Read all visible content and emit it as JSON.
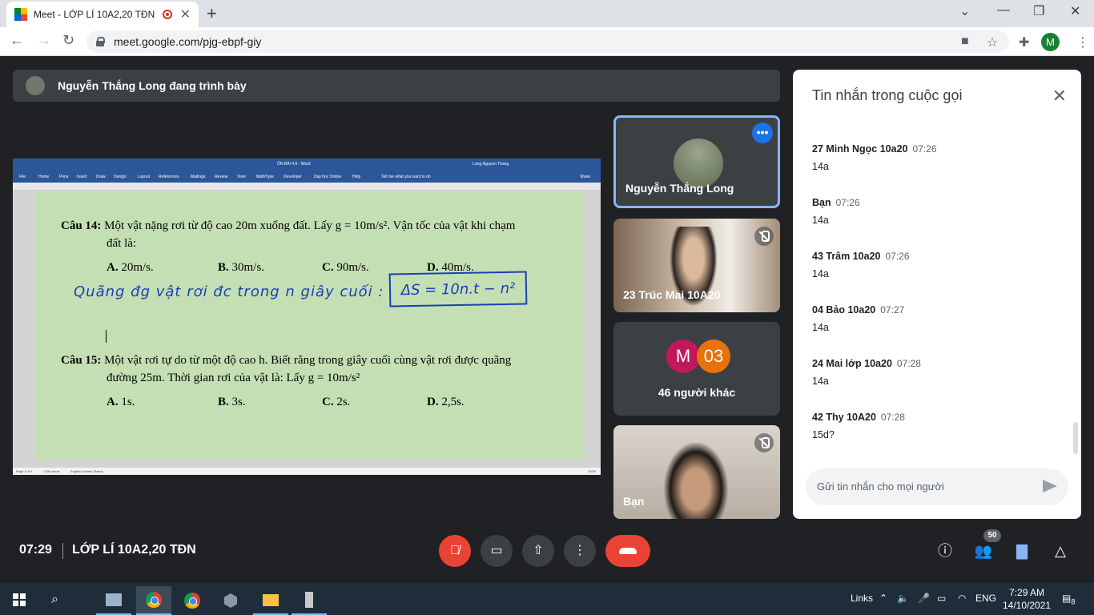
{
  "browser": {
    "tab_title": "Meet - LỚP LÍ 10A2,20 TĐN",
    "tab_close": "✕",
    "new_tab": "+",
    "url": "meet.google.com/pjg-ebpf-giy",
    "profile_initial": "M"
  },
  "meet": {
    "presenting_banner": "Nguyễn Thắng Long đang trình bày",
    "time": "07:29",
    "meeting_name": "LỚP LÍ 10A2,20 TĐN",
    "participants_count": "50",
    "colors": {
      "end_call": "#ea4335",
      "accent": "#8ab4f8",
      "tile_bg": "#3c4043"
    }
  },
  "word_doc": {
    "window_title": "ÔN BÀI 4,5 - Word",
    "user_name": "Long Nguyen Thang",
    "ribbon_tabs": [
      "File",
      "Home",
      "Pens",
      "Insert",
      "Draw",
      "Design",
      "Layout",
      "References",
      "Mailings",
      "Review",
      "View",
      "MathType",
      "Developer",
      "Day hoc Online",
      "Help",
      "Tell me what you want to do",
      "Share"
    ],
    "q14": {
      "label": "Câu 14:",
      "text1": "Một vật nặng rơi từ độ cao 20m xuống đất. Lấy g = 10m/s². Vận tốc của vật khi chạm",
      "text2": "đất là:",
      "options": [
        {
          "letter": "A.",
          "value": "20m/s."
        },
        {
          "letter": "B.",
          "value": "30m/s."
        },
        {
          "letter": "C.",
          "value": "90m/s."
        },
        {
          "letter": "D.",
          "value": "40m/s."
        }
      ]
    },
    "handwriting": "Quãng đg vật rơi đc trong n giây cuối :",
    "handwriting_box": "ΔS = 10n.t − n²",
    "q15": {
      "label": "Câu 15:",
      "text1": "Một vật rơi tự do từ một độ cao h. Biết rằng trong giây cuối cùng vật rơi được quãng",
      "text2": "đường 25m. Thời gian rơi của vật là: Lấy g = 10m/s²",
      "options": [
        {
          "letter": "A.",
          "value": "1s."
        },
        {
          "letter": "B.",
          "value": "3s."
        },
        {
          "letter": "C.",
          "value": "2s."
        },
        {
          "letter": "D.",
          "value": "2,5s."
        }
      ]
    },
    "status": {
      "page": "Page 3 of 4",
      "words": "1336 words",
      "language": "English (United States)",
      "zoom": "100%"
    }
  },
  "tiles": [
    {
      "name": "Nguyễn Thắng Long"
    },
    {
      "name": "23 Trúc Mai 10A20"
    },
    {
      "name": "46 người khác",
      "avatars": [
        {
          "label": "M",
          "color": "#c2185b"
        },
        {
          "label": "03",
          "color": "#e8710a"
        }
      ]
    },
    {
      "name": "Bạn"
    }
  ],
  "chat": {
    "title": "Tin nhắn trong cuộc gọi",
    "input_placeholder": "Gửi tin nhắn cho mọi người",
    "messages": [
      {
        "sender": "27 Minh Ngọc 10a20",
        "time": "07:26",
        "text": "14a"
      },
      {
        "sender": "Bạn",
        "time": "07:26",
        "text": "14a"
      },
      {
        "sender": "43 Trâm 10a20",
        "time": "07:26",
        "text": "14a"
      },
      {
        "sender": "04 Bảo 10a20",
        "time": "07:27",
        "text": "14a"
      },
      {
        "sender": "24 Mai lớp 10a20",
        "time": "07:28",
        "text": "14a"
      },
      {
        "sender": "42 Thy 10A20",
        "time": "07:28",
        "text": "15d?"
      }
    ]
  },
  "taskbar": {
    "links": "Links",
    "language": "ENG",
    "clock_time": "7:29 AM",
    "clock_date": "14/10/2021",
    "notification_count": "8"
  }
}
